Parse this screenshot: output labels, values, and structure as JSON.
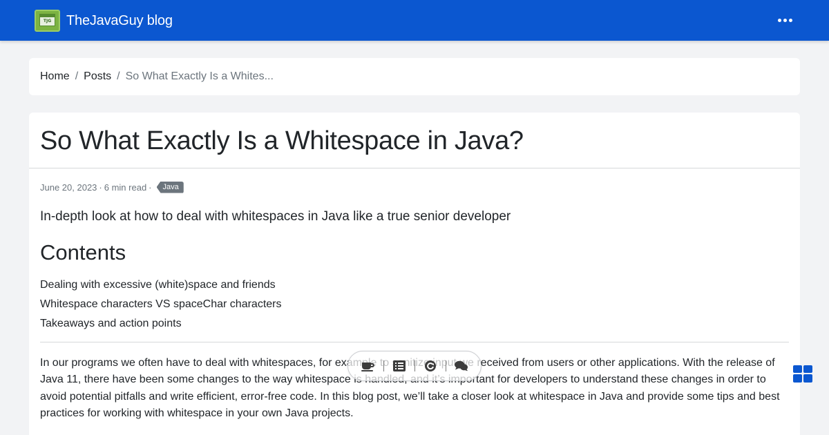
{
  "navbar": {
    "brand": "TheJavaGuy blog",
    "logo_text": "TJG",
    "menu_icon": "more-horizontal-icon",
    "color": "#0b57d0"
  },
  "breadcrumb": {
    "items": [
      "Home",
      "Posts"
    ],
    "separator": "/",
    "current": "So What Exactly Is a Whites..."
  },
  "article": {
    "title": "So What Exactly Is a Whitespace in Java?",
    "date": "June 20, 2023",
    "read_time": "6 min read",
    "meta_separator": "·",
    "tag": "Java",
    "lead": "In-depth look at how to deal with whitespaces in Java like a true senior developer",
    "contents_heading": "Contents",
    "toc": [
      "Dealing with excessive (white)space and friends",
      "Whitespace characters VS spaceChar characters",
      "Takeaways and action points"
    ],
    "paragraph": "In our programs we often have to deal with whitespaces, for example to sanitize input we received from users or other applications. With the release of Java 11, there have been some changes to the way whitespace is handled, and it’s important for developers to understand these changes in order to avoid potential pitfalls and write efficient, error-free code. In this blog post, we’ll take a closer look at whitespace in Java and provide some tips and best practices for working with whitespace in your own Java projects."
  },
  "floating_toolbar": {
    "icons": [
      "coffee-icon",
      "list-icon",
      "refresh-icon",
      "comments-icon"
    ]
  },
  "side_menu": {
    "icon": "windows-grid-icon",
    "color": "#0b57d0"
  }
}
